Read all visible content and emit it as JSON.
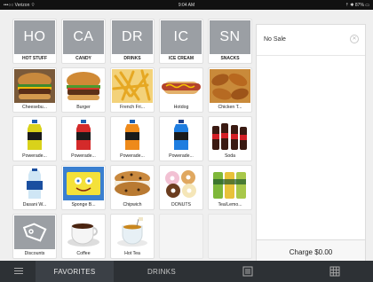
{
  "statusbar": {
    "carrier": "•••○○ Verizon ⌔",
    "time": "9:04 AM",
    "battery": "⇡ ✱ 87% ▭"
  },
  "tiles": [
    {
      "kind": "cat",
      "abbr": "HO",
      "label": "HOT STUFF"
    },
    {
      "kind": "cat",
      "abbr": "CA",
      "label": "CANDY"
    },
    {
      "kind": "cat",
      "abbr": "DR",
      "label": "DRINKS"
    },
    {
      "kind": "cat",
      "abbr": "IC",
      "label": "ICE CREAM"
    },
    {
      "kind": "cat",
      "abbr": "SN",
      "label": "SNACKS"
    },
    {
      "kind": "item",
      "icon": "cheeseburger-image",
      "label": "Cheesebu..."
    },
    {
      "kind": "item",
      "icon": "burger-image",
      "label": "Burger"
    },
    {
      "kind": "item",
      "icon": "french-fries-image",
      "label": "French Fri..."
    },
    {
      "kind": "item",
      "icon": "hotdog-image",
      "label": "Hotdog"
    },
    {
      "kind": "item",
      "icon": "chicken-tenders-image",
      "label": "Chicken T..."
    },
    {
      "kind": "item",
      "icon": "powerade-yellow-image",
      "label": "Powerade..."
    },
    {
      "kind": "item",
      "icon": "powerade-red-image",
      "label": "Powerade..."
    },
    {
      "kind": "item",
      "icon": "powerade-orange-image",
      "label": "Powerade..."
    },
    {
      "kind": "item",
      "icon": "powerade-blue-image",
      "label": "Powerade..."
    },
    {
      "kind": "item",
      "icon": "soda-bottles-image",
      "label": "Soda"
    },
    {
      "kind": "item",
      "icon": "dasani-water-image",
      "label": "Dasani W..."
    },
    {
      "kind": "item",
      "icon": "spongebob-pop-image",
      "label": "Sponge B..."
    },
    {
      "kind": "item",
      "icon": "chipwich-image",
      "label": "Chipwich"
    },
    {
      "kind": "item",
      "icon": "donuts-image",
      "label": "DONUTS"
    },
    {
      "kind": "item",
      "icon": "tea-lemonade-image",
      "label": "Tea/Lemo..."
    },
    {
      "kind": "item",
      "icon": "discount-tag-icon",
      "label": "Discounts"
    },
    {
      "kind": "item",
      "icon": "coffee-image",
      "label": "Coffee"
    },
    {
      "kind": "item",
      "icon": "hot-tea-image",
      "label": "Hot Tea"
    },
    {
      "kind": "empty",
      "label": ""
    },
    {
      "kind": "empty",
      "label": ""
    }
  ],
  "order_panel": {
    "title": "No Sale",
    "clear_icon": "close-circle-icon",
    "charge_label": "Charge $0.00"
  },
  "bottombar": {
    "menu_icon": "hamburger-menu-icon",
    "tabs": [
      {
        "label": "FAVORITES",
        "active": true
      },
      {
        "label": "DRINKS",
        "active": false
      }
    ],
    "keypad_icon": "keypad-icon",
    "grid_icon": "grid-icon"
  },
  "colors": {
    "category_tile": "#9b9fa4",
    "bottombar": "#2d3135",
    "active_tab": "#3b4046"
  }
}
